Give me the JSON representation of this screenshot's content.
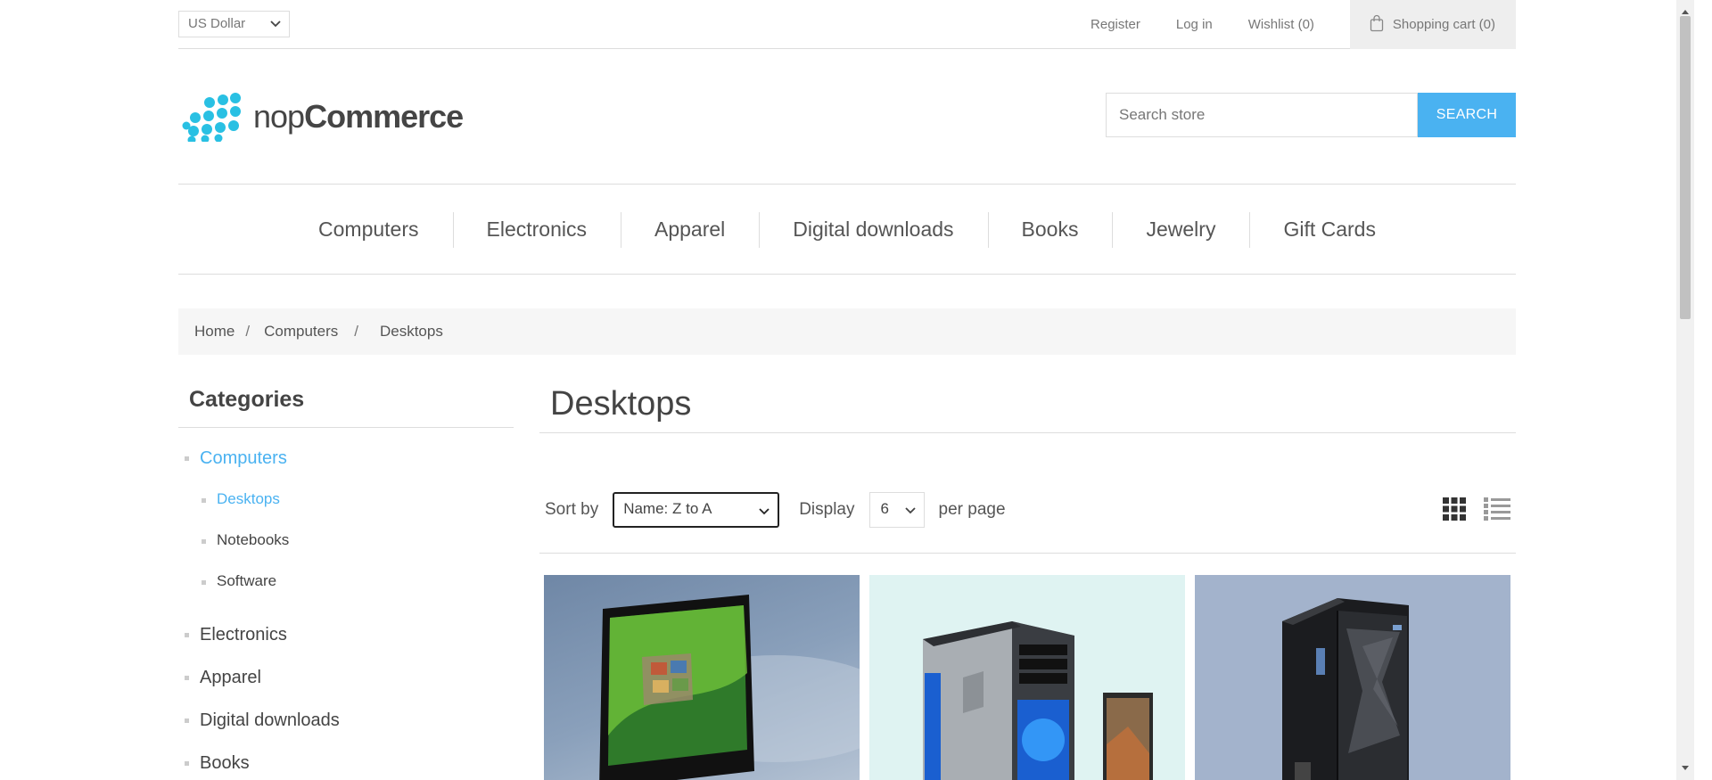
{
  "header": {
    "currency": "US Dollar",
    "links": {
      "register": "Register",
      "login": "Log in",
      "wishlist": "Wishlist (0)",
      "cart": "Shopping cart (0)"
    },
    "logo": {
      "prefix": "nop",
      "suffix": "Commerce"
    },
    "search": {
      "placeholder": "Search store",
      "button": "SEARCH"
    }
  },
  "menu": [
    "Computers",
    "Electronics",
    "Apparel",
    "Digital downloads",
    "Books",
    "Jewelry",
    "Gift Cards"
  ],
  "breadcrumb": {
    "home": "Home",
    "sep": "/",
    "parent": "Computers",
    "current": "Desktops"
  },
  "sidebar": {
    "title": "Categories",
    "categories": [
      {
        "label": "Computers",
        "active": true,
        "subs": [
          {
            "label": "Desktops",
            "active": true
          },
          {
            "label": "Notebooks",
            "active": false
          },
          {
            "label": "Software",
            "active": false
          }
        ]
      },
      {
        "label": "Electronics"
      },
      {
        "label": "Apparel"
      },
      {
        "label": "Digital downloads"
      },
      {
        "label": "Books"
      }
    ]
  },
  "main": {
    "title": "Desktops",
    "sort_label": "Sort by",
    "sort_value": "Name: Z to A",
    "display_label": "Display",
    "display_value": "6",
    "per_page_label": "per page"
  },
  "products": [
    {
      "image": "all-in-one-monitor",
      "bg": "#7d96b3"
    },
    {
      "image": "gaming-tower-pc",
      "bg": "#dff3f2"
    },
    {
      "image": "server-tower",
      "bg": "#a3b3cc"
    }
  ],
  "colors": {
    "accent": "#4ab2f1",
    "text": "#444444",
    "border": "#dddddd"
  }
}
